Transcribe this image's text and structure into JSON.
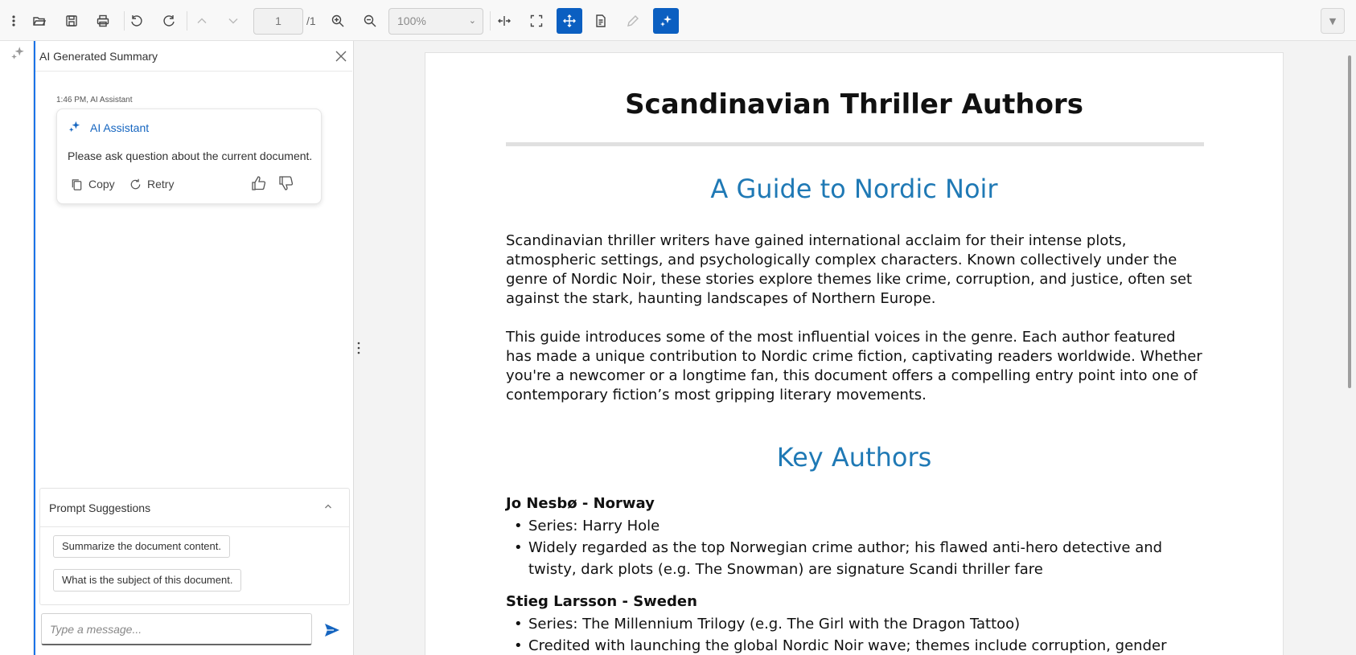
{
  "toolbar": {
    "page_number": "1",
    "page_total": "/1",
    "zoom_value": "100%",
    "icons": [
      "more-options-icon",
      "open-file-icon",
      "save-icon",
      "print-icon",
      "undo-icon",
      "redo-icon",
      "previous-page-icon",
      "next-page-icon",
      "zoom-in-icon",
      "zoom-out-icon",
      "fit-width-icon",
      "fit-page-icon",
      "pan-icon",
      "text-select-icon",
      "annotation-edit-icon",
      "ai-assistant-icon",
      "collapse-toolbar-icon"
    ],
    "accent_color": "#0b5fc1"
  },
  "ai_panel": {
    "title": "AI Generated Summary",
    "message": {
      "time_author": "1:46 PM, AI Assistant",
      "author": "AI Assistant",
      "text": "Please ask question about the current document.",
      "copy_label": "Copy",
      "retry_label": "Retry"
    },
    "suggestions": {
      "title": "Prompt Suggestions",
      "items": [
        "Summarize the document content.",
        "What is the subject of this document."
      ]
    },
    "input_placeholder": "Type a message..."
  },
  "document": {
    "title": "Scandinavian Thriller Authors",
    "subtitle": "A Guide to Nordic Noir",
    "paragraphs": [
      "Scandinavian thriller writers have gained international acclaim for their intense plots, atmospheric settings, and psychologically complex characters. Known collectively under the genre of Nordic Noir, these stories explore themes like crime, corruption, and justice, often set against the stark, haunting landscapes of Northern Europe.",
      "This guide introduces some of the most influential voices in the genre. Each author featured has made a unique contribution to Nordic crime fiction, captivating readers worldwide. Whether you're a newcomer or a longtime fan, this document offers a compelling entry point into one of contemporary fiction’s most gripping literary movements."
    ],
    "section_heading": "Key Authors",
    "authors": [
      {
        "name": "Jo Nesbø - Norway",
        "bullets": [
          "Series: Harry Hole",
          "Widely regarded as the top Norwegian crime author; his flawed anti-hero detective and twisty, dark plots (e.g. The Snowman) are signature Scandi thriller fare"
        ]
      },
      {
        "name": "Stieg Larsson - Sweden",
        "bullets": [
          "Series: The Millennium Trilogy (e.g. The Girl with the Dragon Tattoo)",
          "Credited with launching the global Nordic Noir wave; themes include corruption, gender violence,"
        ]
      }
    ],
    "heading_color": "#1f79b5"
  }
}
